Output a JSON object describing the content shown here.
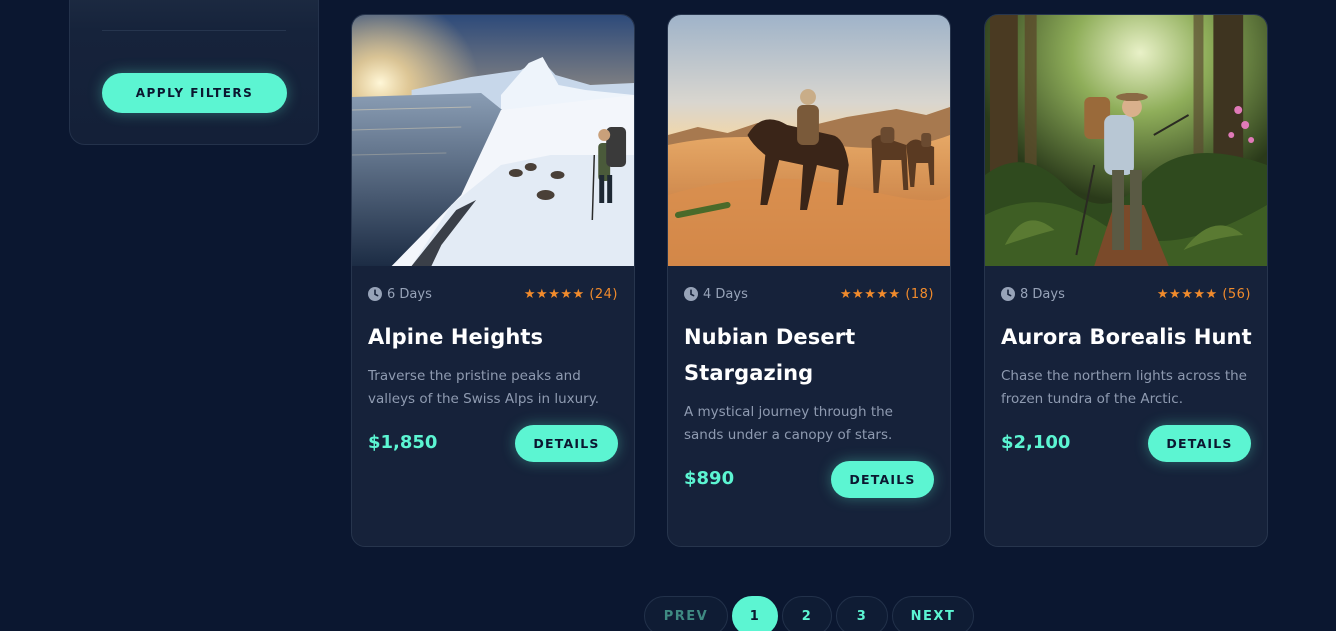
{
  "filters": {
    "apply_label": "APPLY FILTERS"
  },
  "cards": [
    {
      "image": "alpine-expedition-photo",
      "duration": "6 Days",
      "stars": "★★★★★",
      "reviews": "(24)",
      "title": "Alpine Heights",
      "description": "Traverse the pristine peaks and valleys of the Swiss Alps in luxury.",
      "price": "$1,850",
      "details_label": "DETAILS"
    },
    {
      "image": "desert-caravan-photo",
      "duration": "4 Days",
      "stars": "★★★★★",
      "reviews": "(18)",
      "title": "Nubian Desert Stargazing",
      "description": "A mystical journey through the sands under a canopy of stars.",
      "price": "$890",
      "details_label": "DETAILS"
    },
    {
      "image": "jungle-explorer-photo",
      "duration": "8 Days",
      "stars": "★★★★★",
      "reviews": "(56)",
      "title": "Aurora Borealis Hunt",
      "description": "Chase the northern lights across the frozen tundra of the Arctic.",
      "price": "$2,100",
      "details_label": "DETAILS"
    }
  ],
  "pagination": {
    "prev": "PREV",
    "pages": [
      "1",
      "2",
      "3"
    ],
    "active_page": "1",
    "next": "NEXT"
  },
  "colors": {
    "background": "#0b1730",
    "card": "#16223a",
    "accent": "#5cf5d2",
    "star": "#f18b2c",
    "muted_text": "#8f9bb1"
  }
}
